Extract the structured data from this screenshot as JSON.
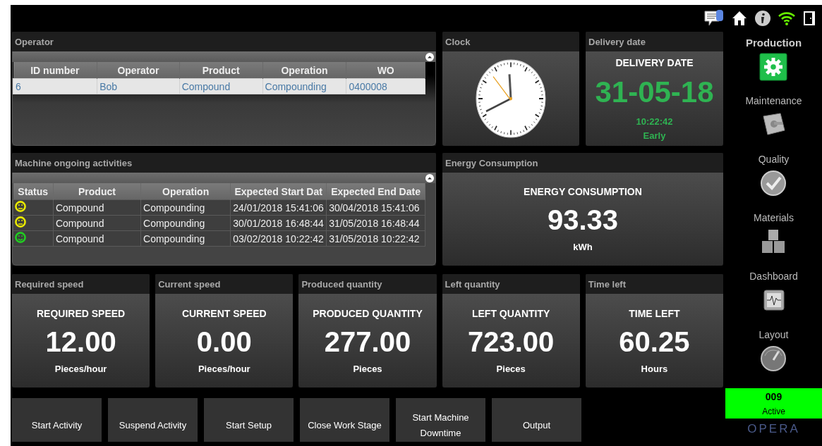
{
  "operator_panel": {
    "title": "Operator",
    "columns": [
      "ID number",
      "Operator",
      "Product",
      "Operation",
      "WO"
    ],
    "rows": [
      {
        "cells": [
          "6",
          "Bob",
          "Compound",
          "Compounding",
          "0400008"
        ],
        "selected": true
      }
    ]
  },
  "clock": {
    "title": "Clock"
  },
  "delivery": {
    "title": "Delivery date",
    "label": "DELIVERY DATE",
    "value": "31-05-18",
    "time": "10:22:42",
    "state": "Early"
  },
  "activities_panel": {
    "title": "Machine ongoing activities",
    "columns": [
      "Status",
      "Product",
      "Operation",
      "Expected Start Dat",
      "Expected End Date"
    ],
    "rows": [
      {
        "cells": [
          {
            "kind": "neutral",
            "color": "#e8e800"
          },
          "Compound",
          "Compounding",
          "24/01/2018 15:41:06",
          "30/04/2018 15:41:06"
        ]
      },
      {
        "cells": [
          {
            "kind": "neutral",
            "color": "#e8e800"
          },
          "Compound",
          "Compounding",
          "30/01/2018 16:48:44",
          "31/05/2018 16:48:44"
        ]
      },
      {
        "cells": [
          {
            "kind": "happy",
            "color": "#22cc22"
          },
          "Compound",
          "Compounding",
          "03/02/2018 10:22:42",
          "31/05/2018 10:22:42"
        ]
      }
    ]
  },
  "energy": {
    "title": "Energy Consumption",
    "label": "ENERGY CONSUMPTION",
    "value": "93.33",
    "unit": "kWh"
  },
  "metrics": [
    {
      "title": "Required speed",
      "label": "REQUIRED SPEED",
      "value": "12.00",
      "unit": "Pieces/hour"
    },
    {
      "title": "Current speed",
      "label": "CURRENT SPEED",
      "value": "0.00",
      "unit": "Pieces/hour"
    },
    {
      "title": "Produced quantity",
      "label": "PRODUCED QUANTITY",
      "value": "277.00",
      "unit": "Pieces"
    },
    {
      "title": "Left quantity",
      "label": "LEFT QUANTITY",
      "value": "723.00",
      "unit": "Pieces"
    },
    {
      "title": "Time left",
      "label": "TIME LEFT",
      "value": "60.25",
      "unit": "Hours"
    }
  ],
  "actions": [
    "Start Activity",
    "Suspend Activity",
    "Start Setup",
    "Close Work Stage",
    "Start Machine Downtime",
    "Output"
  ],
  "sidebar": {
    "items": [
      {
        "label": "Production",
        "selected": true
      },
      {
        "label": "Maintenance",
        "selected": false
      },
      {
        "label": "Quality",
        "selected": false
      },
      {
        "label": "Materials",
        "selected": false
      },
      {
        "label": "Dashboard",
        "selected": false
      },
      {
        "label": "Layout",
        "selected": false
      }
    ]
  },
  "machine_status": {
    "code": "009",
    "state": "Active"
  },
  "logo": "OPERA"
}
